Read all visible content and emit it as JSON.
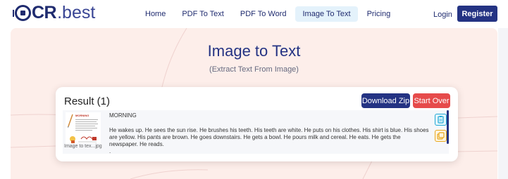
{
  "brand": {
    "logo_bold": "CR",
    "logo_light": ".best"
  },
  "nav": {
    "items": [
      {
        "label": "Home",
        "active": false
      },
      {
        "label": "PDF To Text",
        "active": false
      },
      {
        "label": "PDF To Word",
        "active": false
      },
      {
        "label": "Image To Text",
        "active": true
      },
      {
        "label": "Pricing",
        "active": false
      }
    ],
    "login_label": "Login",
    "register_label": "Register"
  },
  "hero": {
    "title": "Image to Text",
    "subtitle": "(Extract Text From Image)"
  },
  "result": {
    "heading": "Result (1)",
    "download_label": "Download Zip",
    "start_over_label": "Start Over",
    "file": {
      "thumbnail_caption": "Image to tex...jpg",
      "thumbnail_heading": "MORNING",
      "text_heading": "MORNING",
      "text_body": "He wakes up. He sees the sun rise. He brushes his teeth. His teeth are white. He puts on his clothes. His shirt is blue. His shoes are yellow. His pants are brown. He goes downstairs. He gets a bowl. He pours milk and cereal. He eats. He gets the newspaper. He reads.",
      "text_more": "."
    }
  },
  "colors": {
    "brand_navy": "#243383",
    "accent_red": "#e64b4b",
    "hero_bg": "#fdeeea",
    "active_tab_bg": "#e4f2fb",
    "copy_icon": "#22a8d6",
    "duplicate_icon": "#e9a91e"
  },
  "icons": {
    "copy": "copy-icon",
    "duplicate": "duplicate-icon"
  }
}
